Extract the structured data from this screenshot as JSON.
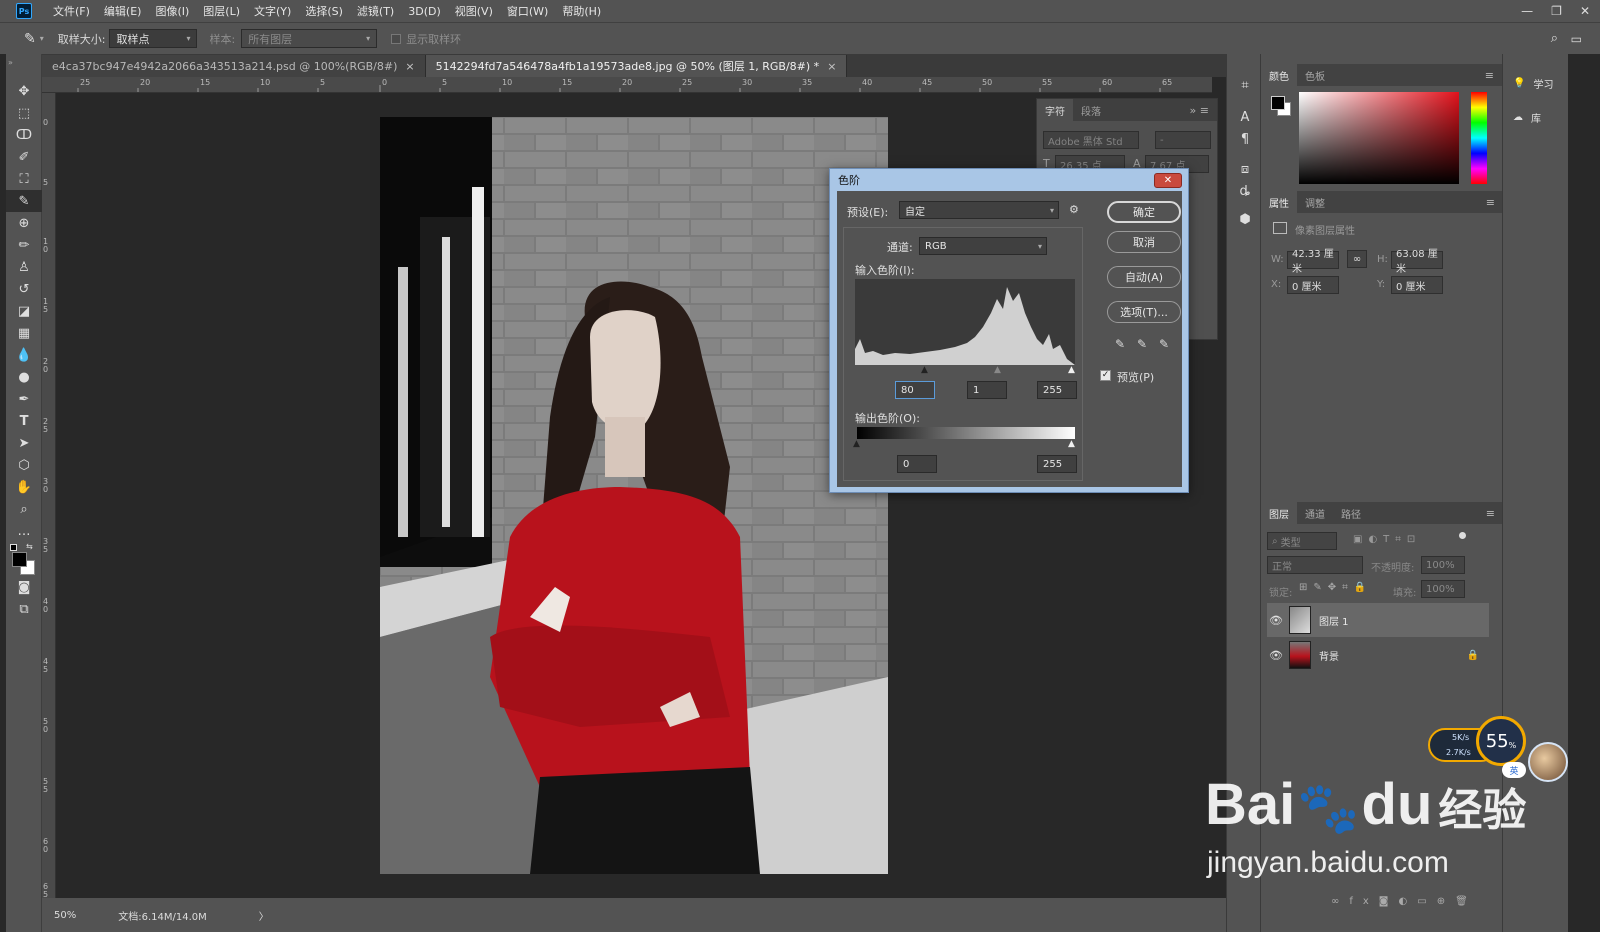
{
  "menubar": {
    "logo": "Ps",
    "items": [
      "文件(F)",
      "编辑(E)",
      "图像(I)",
      "图层(L)",
      "文字(Y)",
      "选择(S)",
      "滤镜(T)",
      "3D(D)",
      "视图(V)",
      "窗口(W)",
      "帮助(H)"
    ]
  },
  "options": {
    "sample_size_label": "取样大小:",
    "sample_size_value": "取样点",
    "sample_label": "样本:",
    "sample_value": "所有图层",
    "show_ring_label": "显示取样环"
  },
  "tabs": [
    {
      "label": "e4ca37bc947e4942a2066a343513a214.psd @ 100%(RGB/8#)",
      "close": "×"
    },
    {
      "label": "5142294fd7a546478a4fb1a19573ade8.jpg @ 50% (图层 1, RGB/8#) *",
      "close": "×"
    }
  ],
  "ruler_h": [
    "25",
    "20",
    "15",
    "10",
    "5",
    "0",
    "5",
    "10",
    "15",
    "20",
    "25",
    "30",
    "35",
    "40",
    "45",
    "50",
    "55",
    "60",
    "65"
  ],
  "ruler_v": [
    "0",
    "5",
    "1 0",
    "1 5",
    "2 0",
    "2 5",
    "3 0",
    "3 5",
    "4 0",
    "4 5",
    "5 0",
    "5 5",
    "6 0",
    "6 5"
  ],
  "status": {
    "zoom": "50%",
    "doc": "文档:6.14M/14.0M",
    "arrow": "〉"
  },
  "char_panel": {
    "tabs": [
      "字符",
      "段落"
    ],
    "font": "Adobe 黑体 Std",
    "style": "-",
    "size": "26.35 点",
    "leading": "7.67 点"
  },
  "color_panel": {
    "tabs": [
      "颜色",
      "色板"
    ]
  },
  "props_panel": {
    "tabs": [
      "属性",
      "调整"
    ],
    "title": "像素图层属性",
    "w_label": "W:",
    "w": "42.33 厘米",
    "h_label": "H:",
    "h": "63.08 厘米",
    "x_label": "X:",
    "x": "0 厘米",
    "y_label": "Y:",
    "y": "0 厘米"
  },
  "layers_panel": {
    "tabs": [
      "图层",
      "通道",
      "路径"
    ],
    "filter": "类型",
    "blend": "正常",
    "opacity_label": "不透明度:",
    "opacity": "100%",
    "lock_label": "锁定:",
    "fill_label": "填充:",
    "fill": "100%",
    "layers": [
      {
        "name": "图层 1",
        "selected": true
      },
      {
        "name": "背景",
        "selected": false
      }
    ]
  },
  "learn": {
    "learn": "学习",
    "library": "库"
  },
  "levels": {
    "title": "色阶",
    "close": "✕",
    "preset_label": "预设(E):",
    "preset_value": "自定",
    "channel_label": "通道:",
    "channel_value": "RGB",
    "input_label": "输入色阶(I):",
    "input_black": "80",
    "input_gamma": "1",
    "input_white": "255",
    "output_label": "输出色阶(O):",
    "output_black": "0",
    "output_white": "255",
    "btn_ok": "确定",
    "btn_cancel": "取消",
    "btn_auto": "自动(A)",
    "btn_options": "选项(T)...",
    "preview_label": "预览(P)"
  },
  "net_widget": {
    "up": "5K/s",
    "down": "2.7K/s",
    "percent": "55",
    "unit": "%",
    "ime": "英"
  },
  "watermark": {
    "brand": "Bai",
    "brand2": "du",
    "brand_cn": "经验",
    "url": "jingyan.baidu.com"
  },
  "colors": {
    "ui_dark": "#535353",
    "canvas_bg": "#282828",
    "dialog_frame": "#a9c6e6",
    "sweater_red": "#b8121c"
  }
}
